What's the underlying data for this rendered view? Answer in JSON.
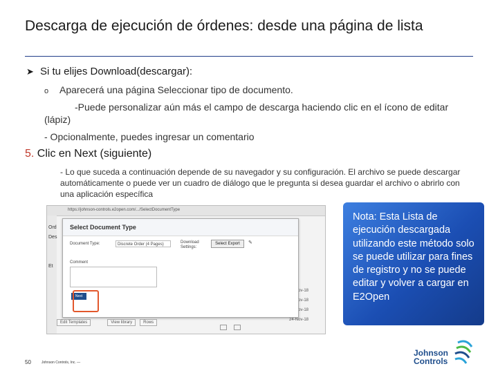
{
  "slide": {
    "title": "Descarga de ejecución de órdenes: desde una página de lista",
    "bullet_main": "Si tu elijes Download(descargar):",
    "bullet_sub1": "Aparecerá una página Seleccionar tipo de documento.",
    "bullet_sub2": "-Puede personalizar aún más el campo de descarga haciendo clic en el ícono de editar (lápiz)",
    "bullet_sub3": "- Opcionalmente, puedes ingresar un comentario",
    "step_number": "5.",
    "step_text": "Clic en Next (siguiente)",
    "step_desc": "- Lo que suceda a continuación depende de su navegador y su configuración. El archivo se puede descargar automáticamente o puede ver un cuadro de diálogo que le pregunta si desea guardar el archivo o abrirlo con una aplicación específica",
    "note": "Nota: Esta Lista de ejecución descargada utilizando este método solo se puede utilizar para fines de registro y no se puede editar y volver a cargar en E2Open",
    "page_number": "50",
    "company_footer": "Johnson Controls, Inc. —",
    "logo_line1": "Johnson",
    "logo_line2": "Controls"
  },
  "screenshot": {
    "url": "https://johnson-controls.e2open.com/.../SelectDocumentType",
    "dialog_title": "Select Document Type",
    "document_type_label": "Document Type:",
    "document_type_value": "Discrete Order (4 Pages)",
    "download_settings_label": "Download Settings:",
    "select_export_button": "Select Export",
    "comment_label": "Comment",
    "next_button": "Next",
    "edit_template_button": "Edit Templates",
    "view_library_button": "View library",
    "rows_button": "Rows",
    "date_1": "24-Nov-18",
    "date_2": "24-Nov-18",
    "date_3": "24-Nov-18",
    "date_4": "24-Nov-18",
    "side_labels": [
      "Ord",
      "Des",
      "",
      "Et",
      ""
    ]
  },
  "colors": {
    "title_rule": "#1f3c88",
    "step_number": "#c0392b",
    "note_background": "#2a63c8",
    "highlight_box": "#e2572b",
    "logo": "#1f4e8c"
  }
}
